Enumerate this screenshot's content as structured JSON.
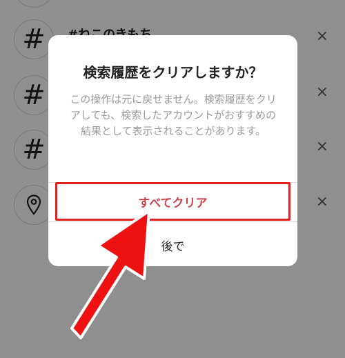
{
  "background_list": {
    "rows": [
      {
        "icon": "hashtag-icon",
        "glyph": "#",
        "title": ""
      },
      {
        "icon": "hashtag-icon",
        "glyph": "#",
        "title": "#ねこのきもち"
      },
      {
        "icon": "hashtag-icon",
        "glyph": "#",
        "title": ""
      },
      {
        "icon": "hashtag-icon",
        "glyph": "#",
        "title": ""
      },
      {
        "icon": "location-pin-icon",
        "glyph": "",
        "title": ""
      }
    ],
    "close_glyph": "×"
  },
  "dialog": {
    "title": "検索履歴をクリアしますか？",
    "message": "この操作は元に戻せません。検索履歴をクリアしても、検索したアカウントがおすすめの結果として表示されることがあります。",
    "clear_all_label": "すべてクリア",
    "later_label": "後で"
  },
  "colors": {
    "overlay": "#8f8f8f",
    "highlight_border": "#e0211f",
    "clear_text": "#c9454e",
    "arrow": "#ee1111"
  }
}
